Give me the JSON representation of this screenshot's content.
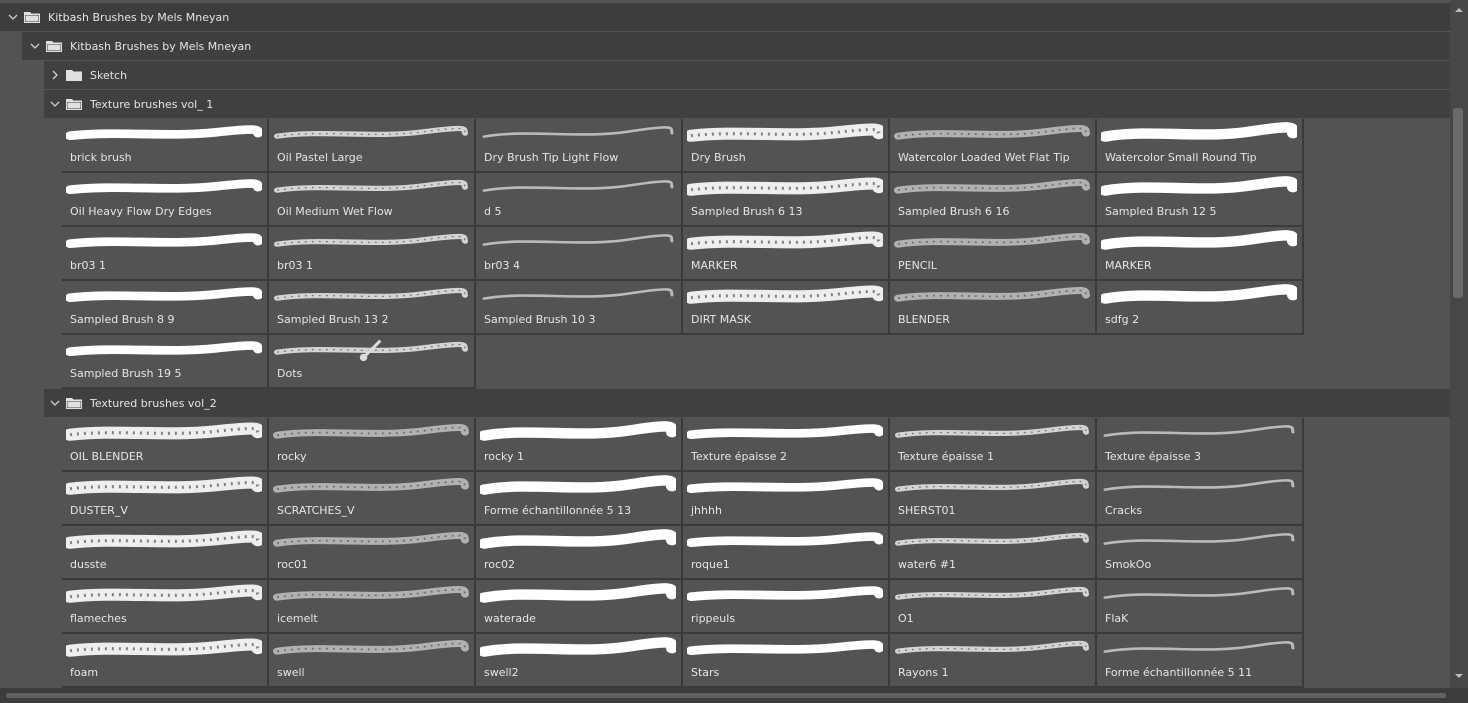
{
  "tree": {
    "root_label": "Kitbash Brushes by Mels Mneyan",
    "sub_label": "Kitbash Brushes by Mels Mneyan",
    "sketch_label": "Sketch",
    "vol1_label": "Texture brushes vol_ 1",
    "vol2_label": "Textured brushes vol_2"
  },
  "vol1_brushes": [
    "brick brush",
    "Oil Pastel Large",
    "Dry Brush Tip Light Flow",
    "Dry Brush",
    "Watercolor Loaded Wet Flat Tip",
    "Watercolor Small Round Tip",
    "Oil Heavy Flow Dry Edges",
    "Oil Medium Wet Flow",
    "d 5",
    "Sampled Brush 6 13",
    "Sampled Brush 6 16",
    "Sampled Brush 12 5",
    "br03 1",
    "br03 1",
    "br03 4",
    "MARKER",
    "PENCIL",
    "MARKER",
    "Sampled Brush 8 9",
    "Sampled Brush 13 2",
    "Sampled Brush 10 3",
    "DIRT MASK",
    "BLENDER",
    "sdfg 2",
    "Sampled Brush 19 5",
    "Dots"
  ],
  "vol2_brushes": [
    "OIL BLENDER",
    "rocky",
    "rocky 1",
    "Texture épaisse 2",
    "Texture épaisse 1",
    "Texture épaisse 3",
    "DUSTER_V",
    "SCRATCHES_V",
    "Forme échantillonnée 5 13",
    "jhhhh",
    "SHERST01",
    "Cracks",
    "dusste",
    "roc01",
    "roc02",
    "roque1",
    "water6 #1",
    "SmokOo",
    "flameches",
    "icemelt",
    "waterade",
    "rippeuls",
    "O1",
    "FlaK",
    "foam",
    "swell",
    "swell2",
    "Stars",
    "Rayons 1",
    "Forme échantillonnée 5 11"
  ],
  "colors": {
    "panel_bg": "#535353",
    "row_bg": "#3f3f3f",
    "text": "#e4e4e4",
    "stroke": "#ffffff"
  },
  "icons": {
    "expanded": "chevron-down-icon",
    "collapsed": "chevron-right-icon",
    "folder": "folder-icon",
    "brush": "brush-icon"
  }
}
